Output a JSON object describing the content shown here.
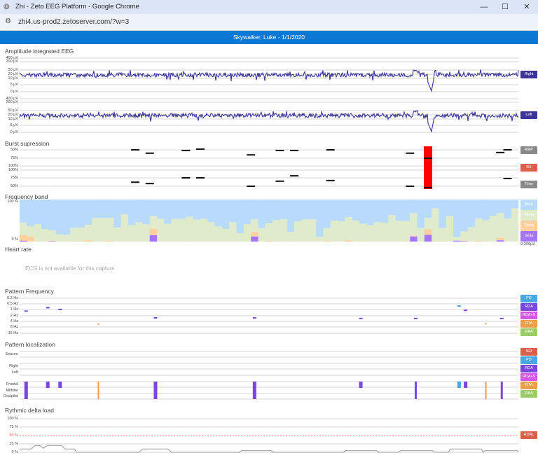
{
  "browser": {
    "title": "Zhi - Zeto EEG Platform - Google Chrome",
    "url": "zhi4.us-prod2.zetoserver.com/?w=3",
    "minimize": "—",
    "maximize": "☐",
    "close": "✕"
  },
  "header": {
    "patient": "Skywalker, Luke - 1/1/2020"
  },
  "colors": {
    "brand": "#0a78d4",
    "trace": "#3a3596",
    "PD": "#4aa8e0",
    "RDA": "#7b45e0",
    "RDA+S": "#d456e6",
    "RTA": "#e8a04a",
    "RAA": "#9ccc6a",
    "SEI": "#d9604a",
    "AMP": "#8a8a8a",
    "BS": "#d9604a",
    "Time": "#8a8a8a",
    "beta": "#b9dbfb",
    "alpha": "#dfebcb",
    "theta": "#fdd0a0",
    "delta": "#a475f5",
    "rdal": "#d9604a"
  },
  "aeeg": {
    "title": "Amplitude integrated EEG",
    "ticks": [
      "400 µV",
      "200 µV",
      "50 µV",
      "20 µV",
      "10 µV",
      "5 µV",
      "0 µV"
    ],
    "channels": [
      {
        "label": "Right"
      },
      {
        "label": "Left"
      }
    ]
  },
  "burst": {
    "title": "Burst supression",
    "amp_ticks": [
      "50%",
      "75%"
    ],
    "bs_ticks": [
      "100%",
      "100%"
    ],
    "time_ticks": [
      "75%",
      "50%"
    ],
    "badges": {
      "amp": "AMP",
      "bs": "BS",
      "time": "Time"
    },
    "amp_values": [
      [
        16,
        50
      ],
      [
        18,
        60
      ],
      [
        23,
        52
      ],
      [
        25,
        48
      ],
      [
        32,
        65
      ],
      [
        36,
        52
      ],
      [
        38,
        52
      ],
      [
        43,
        50
      ],
      [
        54,
        60
      ],
      [
        56.5,
        75
      ],
      [
        66.5,
        58
      ],
      [
        67.5,
        50
      ]
    ],
    "time_values": [
      [
        16,
        62
      ],
      [
        18,
        58
      ],
      [
        23,
        75
      ],
      [
        25,
        75
      ],
      [
        32,
        50
      ],
      [
        36,
        65
      ],
      [
        38,
        81
      ],
      [
        43,
        67
      ],
      [
        54,
        50
      ],
      [
        56.5,
        46
      ],
      [
        67.5,
        73
      ]
    ],
    "bs_values": [
      [
        56.5,
        100
      ]
    ]
  },
  "freq": {
    "title": "Frequency band",
    "ticks": [
      "100 %",
      "0 %"
    ],
    "legend": [
      "Beta",
      "Alpha",
      "Theta",
      "Delta"
    ],
    "scale": "0-200µV",
    "delta": [
      2,
      0,
      0,
      0,
      1,
      0,
      0,
      0,
      0,
      0,
      0,
      0,
      0,
      0,
      0,
      0,
      0,
      0,
      15,
      0,
      0,
      0,
      0,
      0,
      0,
      0,
      0,
      0,
      0,
      0,
      0,
      0,
      12,
      0,
      0,
      0,
      0,
      0,
      0,
      0,
      0,
      0,
      0,
      0,
      0,
      0,
      0,
      0,
      0,
      0,
      0,
      0,
      0,
      0,
      12,
      0,
      16,
      0,
      0,
      0,
      2,
      1,
      0,
      0,
      0,
      0,
      3,
      0,
      0
    ],
    "theta": [
      13,
      12,
      0,
      1,
      1,
      0,
      0,
      1,
      1,
      3,
      1,
      0,
      2,
      0,
      0,
      0,
      0,
      0,
      15,
      0,
      0,
      0,
      0,
      1,
      0,
      0,
      0,
      0,
      0,
      0,
      0,
      0,
      11,
      0,
      2,
      0,
      0,
      1,
      0,
      0,
      0,
      0,
      2,
      0,
      0,
      3,
      0,
      1,
      0,
      0,
      0,
      0,
      0,
      1,
      2,
      0,
      13,
      1,
      1,
      0,
      0,
      1,
      0,
      2,
      0,
      0,
      6,
      0,
      0
    ],
    "alpha": [
      30,
      24,
      41,
      29,
      25,
      17,
      16,
      31,
      32,
      37,
      55,
      56,
      54,
      33,
      65,
      39,
      46,
      41,
      31,
      54,
      42,
      54,
      54,
      58,
      52,
      54,
      46,
      36,
      30,
      46,
      20,
      41,
      30,
      32,
      41,
      51,
      53,
      22,
      48,
      52,
      53,
      11,
      30,
      50,
      48,
      55,
      50,
      41,
      39,
      46,
      45,
      63,
      49,
      48,
      54,
      32,
      27,
      78,
      31,
      61,
      9,
      22,
      34,
      53,
      51,
      61,
      59,
      55,
      79
    ]
  },
  "heart": {
    "title": "Heart rate",
    "message": "ECG is not available for this capture"
  },
  "pattern_frequency": {
    "title": "Pattern Frequency",
    "ticks": [
      "0.2 Hz",
      "0.5 Hz",
      "1 Hz",
      "2 Hz",
      "4 Hz",
      "8 Hz",
      "16 Hz"
    ],
    "tick_values": [
      0.2,
      0.5,
      1,
      2,
      4,
      8,
      16
    ],
    "legend": [
      "PD",
      "RDA",
      "RDA+S",
      "RTA",
      "RAA"
    ],
    "events": [
      {
        "type": "RDA",
        "epoch": 0.9,
        "hz": 1.2
      },
      {
        "type": "RDA",
        "epoch": 3.9,
        "hz": 0.8
      },
      {
        "type": "RDA",
        "epoch": 5.6,
        "hz": 1.0
      },
      {
        "type": "RTA",
        "epoch": 10.9,
        "hz": 5.7
      },
      {
        "type": "RDA",
        "epoch": 18.8,
        "hz": 2.6
      },
      {
        "type": "RDA",
        "epoch": 32.5,
        "hz": 2.6
      },
      {
        "type": "RDA",
        "epoch": 47.2,
        "hz": 2.8
      },
      {
        "type": "RDA",
        "epoch": 54.8,
        "hz": 2.8
      },
      {
        "type": "PD",
        "epoch": 60.8,
        "hz": 0.65
      },
      {
        "type": "RDA",
        "epoch": 61.7,
        "hz": 1.1
      },
      {
        "type": "RTA",
        "epoch": 64.5,
        "hz": 5.3
      },
      {
        "type": "RDA",
        "epoch": 66.7,
        "hz": 2.8
      }
    ]
  },
  "pattern_localization": {
    "title": "Pattern localization",
    "rows": [
      "Seizure",
      "Right",
      "Left",
      "Frontal",
      "Midline",
      "Occipital"
    ],
    "legend": [
      "SEI",
      "PD",
      "RDA",
      "RDA+S",
      "RTA",
      "RAA"
    ],
    "events": [
      {
        "type": "RDA",
        "epoch": 0.9,
        "extent": "all"
      },
      {
        "type": "RDA",
        "epoch": 3.9,
        "extent": "frontal"
      },
      {
        "type": "RDA",
        "epoch": 5.6,
        "extent": "frontal"
      },
      {
        "type": "RTA",
        "epoch": 10.9,
        "extent": "all"
      },
      {
        "type": "RDA",
        "epoch": 18.8,
        "extent": "all"
      },
      {
        "type": "RDA",
        "epoch": 32.5,
        "extent": "all"
      },
      {
        "type": "RDA",
        "epoch": 47.2,
        "extent": "frontal"
      },
      {
        "type": "RDA",
        "epoch": 54.8,
        "extent": "all"
      },
      {
        "type": "PD",
        "epoch": 60.8,
        "extent": "frontal"
      },
      {
        "type": "RDA",
        "epoch": 61.7,
        "extent": "frontal"
      },
      {
        "type": "RTA",
        "epoch": 64.5,
        "extent": "all"
      },
      {
        "type": "RDA",
        "epoch": 66.7,
        "extent": "all"
      }
    ]
  },
  "rdl": {
    "title": "Rythmic delta load",
    "ticks": [
      "100 %",
      "75 %",
      "50 %",
      "25 %",
      "0 %"
    ],
    "threshold": 50,
    "badge": "RDAL",
    "points": [
      [
        0,
        10
      ],
      [
        1.6,
        10
      ],
      [
        2.1,
        20
      ],
      [
        2.8,
        20
      ],
      [
        3.3,
        12
      ],
      [
        3.8,
        20
      ],
      [
        5.8,
        20
      ],
      [
        6.3,
        10
      ],
      [
        7.6,
        10
      ],
      [
        7.9,
        0
      ],
      [
        16.5,
        0
      ],
      [
        17,
        10
      ],
      [
        20.5,
        10
      ],
      [
        21,
        0
      ],
      [
        30.4,
        0
      ],
      [
        30.7,
        5
      ],
      [
        34.8,
        5
      ],
      [
        35.1,
        0
      ],
      [
        44.8,
        0
      ],
      [
        45.1,
        5
      ],
      [
        49.4,
        5
      ],
      [
        49.7,
        0
      ],
      [
        52.4,
        0
      ],
      [
        52.7,
        5
      ],
      [
        57.1,
        5
      ],
      [
        57.4,
        0
      ],
      [
        59.3,
        0
      ],
      [
        59.6,
        10
      ],
      [
        63.9,
        10
      ],
      [
        64.1,
        0
      ],
      [
        64.4,
        5
      ],
      [
        68.8,
        5
      ],
      [
        69,
        0
      ]
    ]
  }
}
